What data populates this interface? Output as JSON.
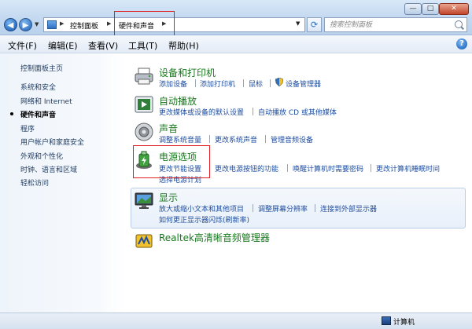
{
  "address_bar": {
    "segments": [
      "控制面板",
      "硬件和声音"
    ]
  },
  "search": {
    "placeholder": "搜索控制面板"
  },
  "menu": [
    {
      "label": "文件(F)"
    },
    {
      "label": "编辑(E)"
    },
    {
      "label": "查看(V)"
    },
    {
      "label": "工具(T)"
    },
    {
      "label": "帮助(H)"
    }
  ],
  "sidebar": {
    "items": [
      {
        "label": "控制面板主页"
      },
      {
        "label": "系统和安全"
      },
      {
        "label": "网络和 Internet"
      },
      {
        "label": "硬件和声音",
        "current": true
      },
      {
        "label": "程序"
      },
      {
        "label": "用户帐户和家庭安全"
      },
      {
        "label": "外观和个性化"
      },
      {
        "label": "时钟、语言和区域"
      },
      {
        "label": "轻松访问"
      }
    ]
  },
  "categories": [
    {
      "title": "设备和打印机",
      "icon": "printer-icon",
      "links": [
        "添加设备",
        "添加打印机",
        "鼠标",
        "设备管理器"
      ]
    },
    {
      "title": "自动播放",
      "icon": "autoplay-icon",
      "links": [
        "更改媒体或设备的默认设置",
        "自动播放 CD 或其他媒体"
      ]
    },
    {
      "title": "声音",
      "icon": "speaker-icon",
      "links": [
        "调整系统音量",
        "更改系统声音",
        "管理音频设备"
      ]
    },
    {
      "title": "电源选项",
      "icon": "battery-icon",
      "links": [
        "更改节能设置",
        "更改电源按钮的功能",
        "唤醒计算机时需要密码",
        "更改计算机睡眠时间",
        "选择电源计划"
      ]
    },
    {
      "title": "显示",
      "icon": "monitor-icon",
      "links": [
        "放大或缩小文本和其他项目",
        "调整屏幕分辨率",
        "连接到外部显示器",
        "如何更正显示器闪烁(刷新率)"
      ]
    },
    {
      "title": "Realtek高清晰音频管理器",
      "icon": "realtek-icon",
      "links": []
    }
  ],
  "status_bar": {
    "text": "计算机"
  },
  "colors": {
    "category_title": "#19771e",
    "link": "#1f4ea0",
    "highlight_box": "#e02020"
  }
}
